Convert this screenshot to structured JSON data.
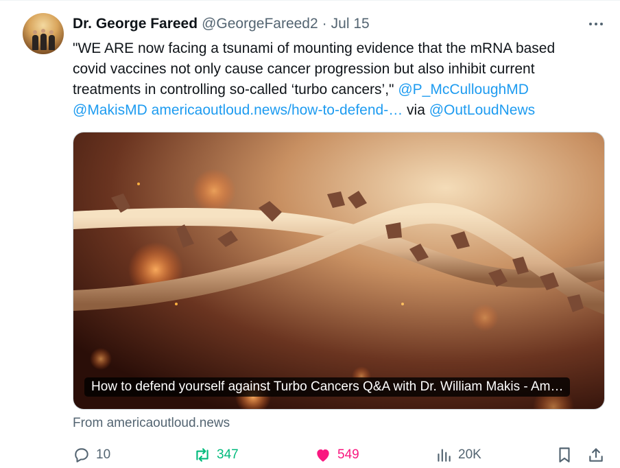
{
  "author": {
    "name": "Dr. George Fareed",
    "handle": "@GeorgeFareed2",
    "separator": "·",
    "date": "Jul 15"
  },
  "tweet": {
    "line1": "\"WE ARE now facing a tsunami of mounting evidence that the mRNA based",
    "line2": "covid vaccines not only cause cancer progression but also inhibit current",
    "line3_text": "treatments in controlling so-called ‘turbo cancers’,\" ",
    "mention1": "@P_McCulloughMD",
    "mention2": "@MakisMD",
    "link": "americaoutloud.news/how-to-defend-…",
    "via_text": " via ",
    "mention3": "@OutLoudNews"
  },
  "card": {
    "caption": "How to defend yourself against Turbo Cancers Q&A with Dr. William Makis - Am…",
    "source": "From americaoutloud.news"
  },
  "actions": {
    "replies": "10",
    "reposts": "347",
    "likes": "549",
    "views": "20K"
  },
  "colors": {
    "link": "#1d9bf0",
    "repost": "#00ba7c",
    "like": "#f91880",
    "muted": "#536471"
  },
  "icons": [
    "more-icon",
    "reply-icon",
    "repost-icon",
    "like-icon",
    "views-icon",
    "bookmark-icon",
    "share-icon"
  ]
}
